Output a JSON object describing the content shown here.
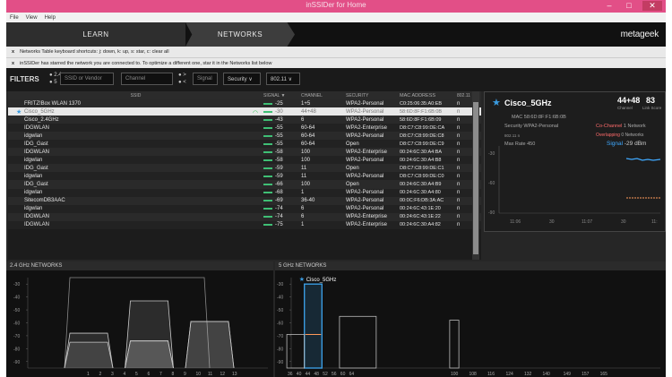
{
  "window": {
    "title": "inSSIDer for Home",
    "controls": {
      "minimize": "–",
      "maximize": "□",
      "close": "✕"
    }
  },
  "menu": [
    "File",
    "View",
    "Help"
  ],
  "nav": {
    "learn": "LEARN",
    "networks": "NETWORKS",
    "logo": "metageek"
  },
  "hints": [
    {
      "close": "x",
      "text": "Networks Table keyboard shortcuts: j: down, k: up, s: star, c: clear all"
    },
    {
      "close": "x",
      "text": "inSSIDer has starred the network you are connected to. To optimize a different one, star it in the Networks list below"
    }
  ],
  "filters": {
    "label": "FILTERS",
    "ssid_placeholder": "SSID or Vendor",
    "channel_placeholder": "Channel",
    "signal_placeholder": "Signal",
    "security_label": "Security ∨",
    "standard_label": "802.11 ∨",
    "radio_a1": "2.4",
    "radio_a2": "5",
    "radio_b1": ">",
    "radio_b2": "<"
  },
  "table": {
    "headers": {
      "ssid": "SSID",
      "signal": "SIGNAL ▼",
      "channel": "CHANNEL",
      "security": "SECURITY",
      "mac": "MAC ADDRESS",
      "std": "802.11"
    },
    "rows": [
      {
        "ssid": "FRITZ!Box WLAN 1370",
        "signal": "-25",
        "channel": "1+5",
        "security": "WPA2-Personal",
        "mac": "C0:25:06:35:A0:EB",
        "std": "n"
      },
      {
        "ssid": "Cisco_5GHz",
        "signal": "-30",
        "channel": "44+48",
        "security": "WPA2-Personal",
        "mac": "58:6D:8F:F1:6B:0B",
        "std": "n",
        "selected": true,
        "starred": true
      },
      {
        "ssid": "Cisco_2.4GHz",
        "signal": "-43",
        "channel": "6",
        "security": "WPA2-Personal",
        "mac": "58:6D:8F:F1:6B:09",
        "std": "n"
      },
      {
        "ssid": "IDGWLAN",
        "signal": "-55",
        "channel": "60-64",
        "security": "WPA2-Enterprise",
        "mac": "D8:C7:C8:99:DE:CA",
        "std": "n"
      },
      {
        "ssid": "idgwlan",
        "signal": "-55",
        "channel": "60-64",
        "security": "WPA2-Personal",
        "mac": "D8:C7:C8:99:DE:C8",
        "std": "n"
      },
      {
        "ssid": "IDG_Gast",
        "signal": "-55",
        "channel": "60-64",
        "security": "Open",
        "mac": "D8:C7:C8:99:DE:C9",
        "std": "n"
      },
      {
        "ssid": "IDGWLAN",
        "signal": "-58",
        "channel": "100",
        "security": "WPA2-Enterprise",
        "mac": "00:24:6C:30:A4:BA",
        "std": "n"
      },
      {
        "ssid": "idgwlan",
        "signal": "-58",
        "channel": "100",
        "security": "WPA2-Personal",
        "mac": "00:24:6C:30:A4:B8",
        "std": "n"
      },
      {
        "ssid": "IDG_Gast",
        "signal": "-59",
        "channel": "11",
        "security": "Open",
        "mac": "D8:C7:C8:99:DE:C1",
        "std": "n"
      },
      {
        "ssid": "idgwlan",
        "signal": "-59",
        "channel": "11",
        "security": "WPA2-Personal",
        "mac": "D8:C7:C8:99:DE:C0",
        "std": "n"
      },
      {
        "ssid": "IDG_Gast",
        "signal": "-66",
        "channel": "100",
        "security": "Open",
        "mac": "00:24:6C:30:A4:B9",
        "std": "n"
      },
      {
        "ssid": "idgwlan",
        "signal": "-68",
        "channel": "1",
        "security": "WPA2-Personal",
        "mac": "00:24:6C:30:A4:80",
        "std": "n"
      },
      {
        "ssid": "SitecomDB3AAC",
        "signal": "-69",
        "channel": "36-40",
        "security": "WPA2-Personal",
        "mac": "00:0C:F6:DB:3A:AC",
        "std": "n"
      },
      {
        "ssid": "idgwlan",
        "signal": "-74",
        "channel": "6",
        "security": "WPA2-Personal",
        "mac": "00:24:6C:43:1E:20",
        "std": "n"
      },
      {
        "ssid": "IDGWLAN",
        "signal": "-74",
        "channel": "6",
        "security": "WPA2-Enterprise",
        "mac": "00:24:6C:43:1E:22",
        "std": "n"
      },
      {
        "ssid": "IDGWLAN",
        "signal": "-75",
        "channel": "1",
        "security": "WPA2-Enterprise",
        "mac": "00:24:6C:30:A4:82",
        "std": "n"
      }
    ]
  },
  "detail": {
    "ssid": "Cisco_5GHz",
    "channel": "44+48",
    "channel_label": "Channel",
    "link_score": "83",
    "link_score_label": "Link Score",
    "mac_label": "MAC",
    "mac": "58:6D:8F:F1:6B:0B",
    "security_label": "Security",
    "security": "WPA2-Personal",
    "std_label": "802.11 n",
    "maxrate_label": "Max Rate",
    "maxrate": "450",
    "cochannel_label": "Co-Channel",
    "cochannel": "1 Network",
    "overlapping_label": "Overlapping",
    "overlapping": "0 Networks",
    "signal_label": "Signal",
    "signal": "-29 dBm",
    "yticks": [
      "-30",
      "-60",
      "-90"
    ],
    "xticks": [
      "11:06",
      "30",
      "11:07",
      "30",
      "11:"
    ],
    "colors": {
      "ssid": "#3a9be0",
      "cochannel": "#ff6b6b",
      "overlapping": "#ff6b6b",
      "signal": "#3fa9ff",
      "line1": "#3fa9ff",
      "line2": "#ff9a5a"
    }
  },
  "panel24": {
    "title": "2.4 GHz NETWORKS",
    "yticks": [
      "-30",
      "-40",
      "-50",
      "-60",
      "-70",
      "-80",
      "-90"
    ],
    "xticks": [
      "1",
      "2",
      "3",
      "4",
      "5",
      "6",
      "7",
      "8",
      "9",
      "10",
      "11",
      "12",
      "13"
    ]
  },
  "panel5": {
    "title": "5 GHz NETWORKS",
    "yticks": [
      "-30",
      "-40",
      "-50",
      "-60",
      "-70",
      "-80",
      "-90"
    ],
    "xticks": [
      "36",
      "40",
      "44",
      "48",
      "52",
      "56",
      "60",
      "64",
      "100",
      "108",
      "116",
      "124",
      "132",
      "140",
      "149",
      "157",
      "165"
    ],
    "label": "Cisco_5GHz"
  },
  "chart_data": [
    {
      "type": "area",
      "title": "2.4 GHz NETWORKS",
      "xlabel": "",
      "ylabel": "",
      "x_ticks": [
        1,
        2,
        3,
        4,
        5,
        6,
        7,
        8,
        9,
        10,
        11,
        12,
        13
      ],
      "ylim": [
        -95,
        -25
      ],
      "series": [
        {
          "channel_range": [
            1,
            9
          ],
          "signal": -25
        },
        {
          "channel": 6,
          "signal": -43
        },
        {
          "channel": 11,
          "signal": -59
        },
        {
          "channel": 11,
          "signal": -59
        },
        {
          "channel": 1,
          "signal": -68
        },
        {
          "channel": 6,
          "signal": -74
        },
        {
          "channel": 6,
          "signal": -74
        },
        {
          "channel": 1,
          "signal": -75
        }
      ]
    },
    {
      "type": "area",
      "title": "5 GHz NETWORKS",
      "xlabel": "",
      "ylabel": "",
      "x_ticks": [
        36,
        40,
        44,
        48,
        52,
        56,
        60,
        64,
        100,
        108,
        116,
        124,
        132,
        140,
        149,
        157,
        165
      ],
      "ylim": [
        -95,
        -25
      ],
      "series": [
        {
          "name": "Cisco_5GHz",
          "channel_range": [
            44,
            48
          ],
          "signal": -30
        },
        {
          "channel_range": [
            60,
            64
          ],
          "signal": -55
        },
        {
          "channel_range": [
            36,
            40
          ],
          "signal": -69
        },
        {
          "channel": 100,
          "signal": -58
        }
      ]
    }
  ]
}
